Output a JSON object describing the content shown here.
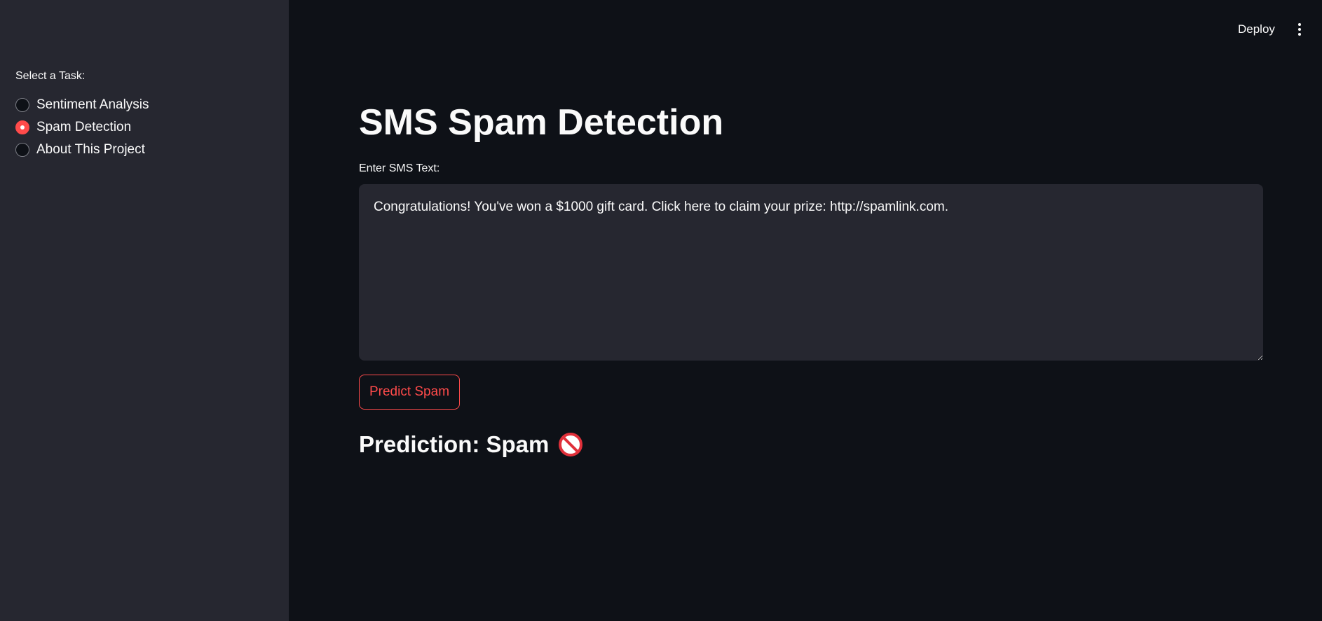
{
  "header": {
    "deploy_label": "Deploy",
    "menu_icon": "vertical-ellipsis-icon"
  },
  "sidebar": {
    "radio_label": "Select a Task:",
    "options": [
      {
        "label": "Sentiment Analysis",
        "selected": false
      },
      {
        "label": "Spam Detection",
        "selected": true
      },
      {
        "label": "About This Project",
        "selected": false
      }
    ],
    "selected_option": "Spam Detection"
  },
  "main": {
    "title": "SMS Spam Detection",
    "input_label": "Enter SMS Text:",
    "input_value": "Congratulations! You've won a $1000 gift card. Click here to claim your prize: http://spamlink.com.",
    "predict_button_label": "Predict Spam",
    "prediction_text": "Prediction: Spam",
    "prediction_icon": "no-entry-icon"
  },
  "colors": {
    "accent": "#ff4b4b",
    "background": "#0e1117",
    "sidebar": "#262730",
    "text": "#fafafa"
  }
}
